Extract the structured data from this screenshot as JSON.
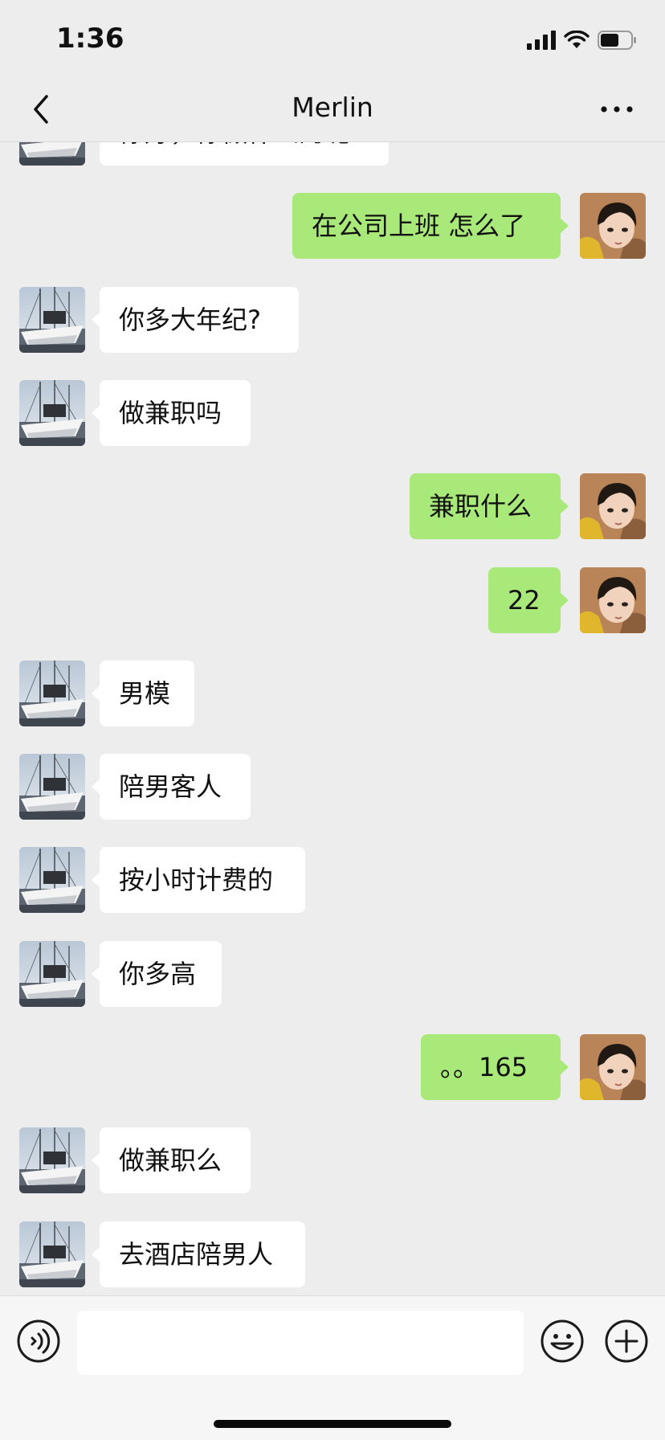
{
  "status_bar": {
    "time": "1:36"
  },
  "nav": {
    "title": "Merlin",
    "back_icon": "chevron-left-icon",
    "more_icon": "more-dots-icon"
  },
  "messages": [
    {
      "side": "left",
      "text": "你好，你做什么的呢"
    },
    {
      "side": "right",
      "text": "在公司上班 怎么了"
    },
    {
      "side": "left",
      "text": "你多大年纪?"
    },
    {
      "side": "left",
      "text": "做兼职吗"
    },
    {
      "side": "right",
      "text": "兼职什么"
    },
    {
      "side": "right",
      "text": "22"
    },
    {
      "side": "left",
      "text": "男模"
    },
    {
      "side": "left",
      "text": "陪男客人"
    },
    {
      "side": "left",
      "text": "按小时计费的"
    },
    {
      "side": "left",
      "text": "你多高"
    },
    {
      "side": "right",
      "text": "。。165"
    },
    {
      "side": "left",
      "text": "做兼职么"
    },
    {
      "side": "left",
      "text": "去酒店陪男人"
    }
  ],
  "input_bar": {
    "placeholder": "",
    "value": "",
    "voice_icon": "voice-icon",
    "emoji_icon": "emoji-icon",
    "plus_icon": "plus-icon"
  },
  "colors": {
    "background": "#ededed",
    "self_bubble": "#a9e97a",
    "other_bubble": "#ffffff"
  }
}
